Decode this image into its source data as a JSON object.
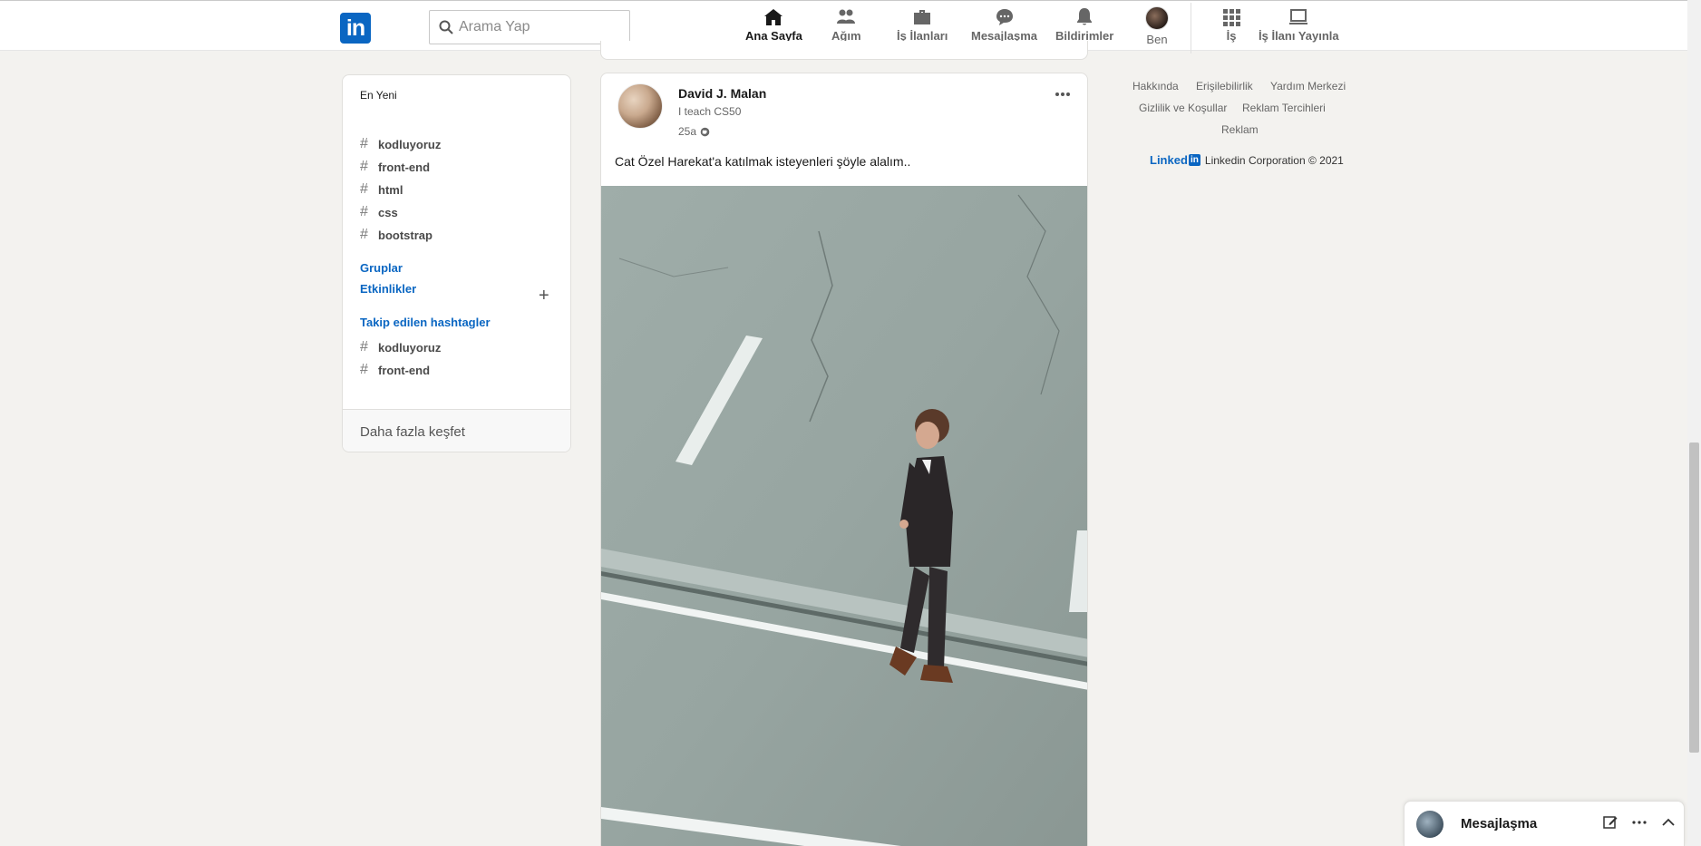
{
  "nav": {
    "search_placeholder": "Arama Yap",
    "items": [
      {
        "label": "Ana Sayfa",
        "icon": "home-icon"
      },
      {
        "label": "Ağım",
        "icon": "network-icon"
      },
      {
        "label": "İş İlanları",
        "icon": "jobs-icon"
      },
      {
        "label": "Mesajlaşma",
        "icon": "messaging-icon"
      },
      {
        "label": "Bildirimler",
        "icon": "bell-icon"
      },
      {
        "label": "Ben",
        "icon": "avatar"
      },
      {
        "label": "İş",
        "icon": "grid-icon"
      },
      {
        "label": "İş İlanı Yayınla",
        "icon": "post-job-icon"
      }
    ]
  },
  "sidebar": {
    "recent_title": "En Yeni",
    "recent_tags": [
      "kodluyoruz",
      "front-end",
      "html",
      "css",
      "bootstrap"
    ],
    "groups_label": "Gruplar",
    "events_label": "Etkinlikler",
    "followed_label": "Takip edilen hashtagler",
    "followed_tags": [
      "kodluyoruz",
      "front-end"
    ],
    "discover_more": "Daha fazla keşfet"
  },
  "post": {
    "author": "David J. Malan",
    "headline": "I teach CS50",
    "time": "25a",
    "text": "Cat Özel Harekat'a katılmak isteyenleri şöyle alalım.."
  },
  "right_footer": {
    "links": [
      "Hakkında",
      "Erişilebilirlik",
      "Yardım Merkezi",
      "Gizlilik ve Koşullar",
      "Reklam Tercihleri",
      "Reklam"
    ],
    "brand_word": "Linked",
    "brand_in": "in",
    "copyright": "Linkedin Corporation © 2021"
  },
  "messaging_dock": {
    "title": "Mesajlaşma"
  },
  "colors": {
    "brand": "#0a66c2",
    "background": "#f3f2ef"
  }
}
